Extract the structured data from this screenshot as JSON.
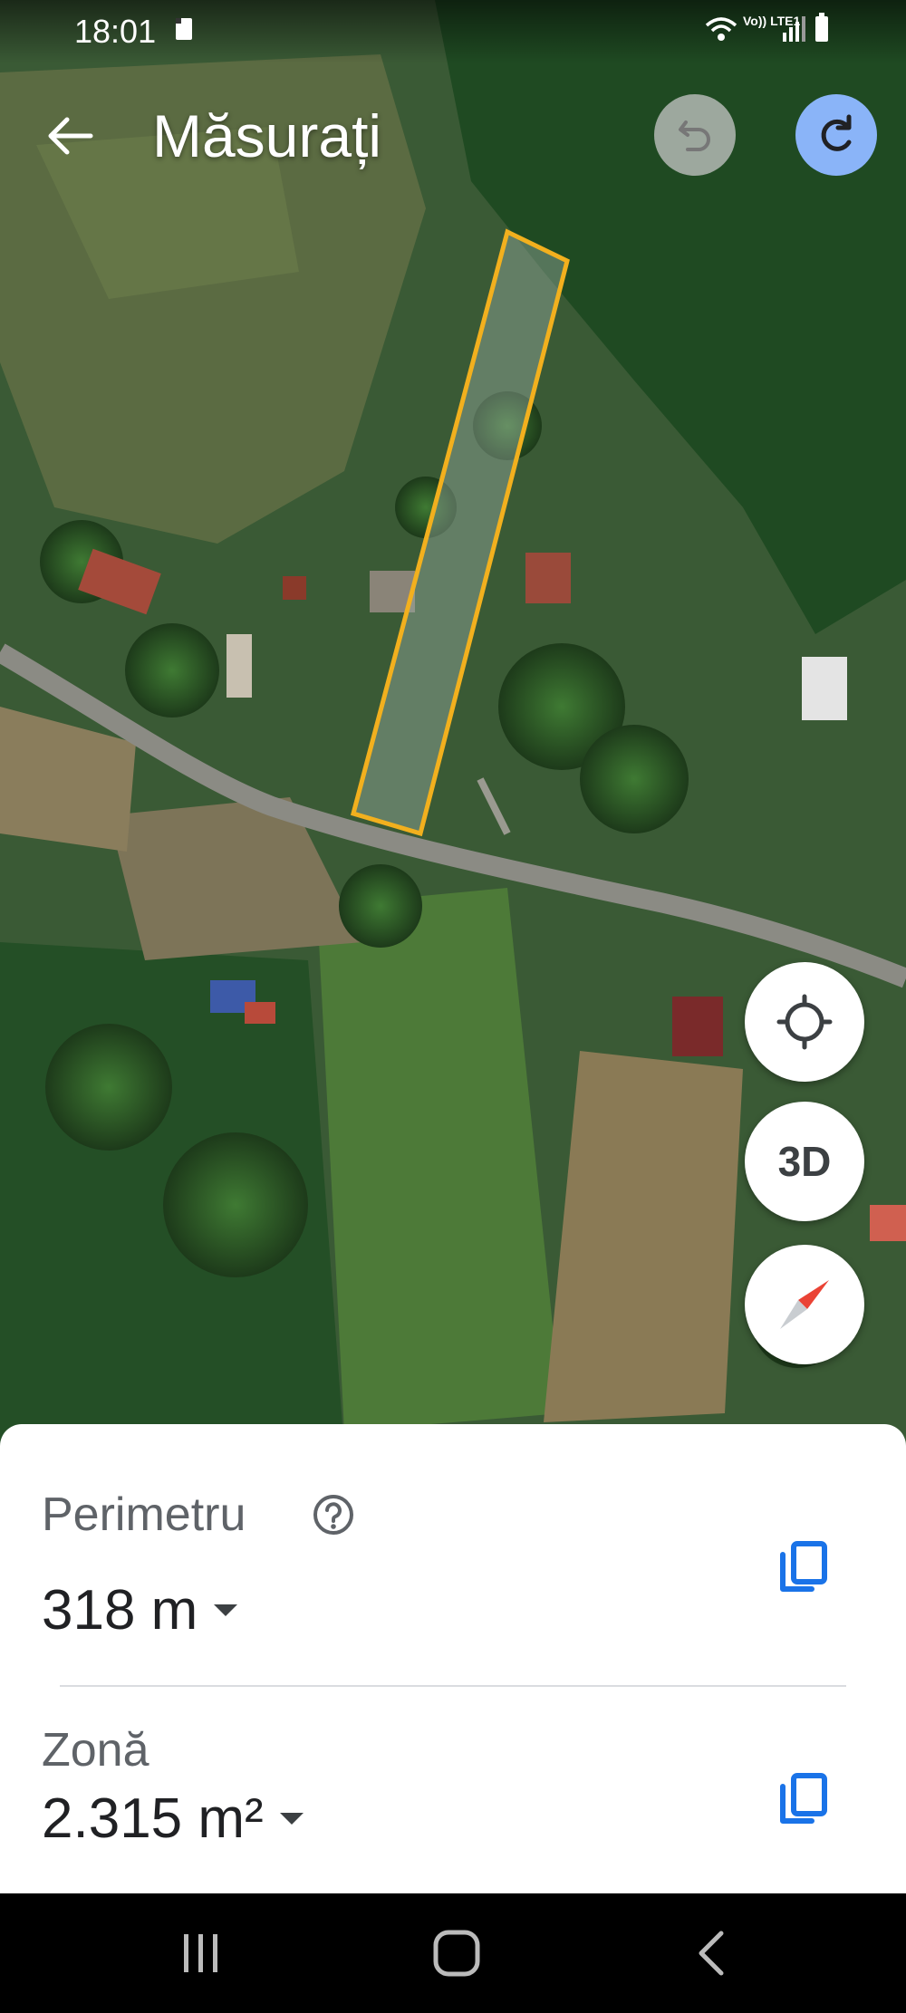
{
  "status_bar": {
    "time": "18:01",
    "network_label": "Vo)) LTE1"
  },
  "header": {
    "title": "Măsurați"
  },
  "controls": {
    "view_3d_label": "3D"
  },
  "measurement": {
    "perimeter_label": "Perimetru",
    "perimeter_value": "318 m",
    "area_label": "Zonă",
    "area_value": "2.315 m²"
  },
  "colors": {
    "accent_blue": "#1a73e8",
    "redo_button": "#8ab4f8",
    "measure_outline": "#f2b01e",
    "compass_red": "#ea4335"
  },
  "icons": [
    "sd-card-icon",
    "wifi-icon",
    "signal-icon",
    "battery-icon",
    "back-arrow-icon",
    "undo-icon",
    "redo-icon",
    "my-location-icon",
    "compass-icon",
    "help-icon",
    "copy-icon",
    "recents-icon",
    "home-icon",
    "nav-back-icon"
  ]
}
